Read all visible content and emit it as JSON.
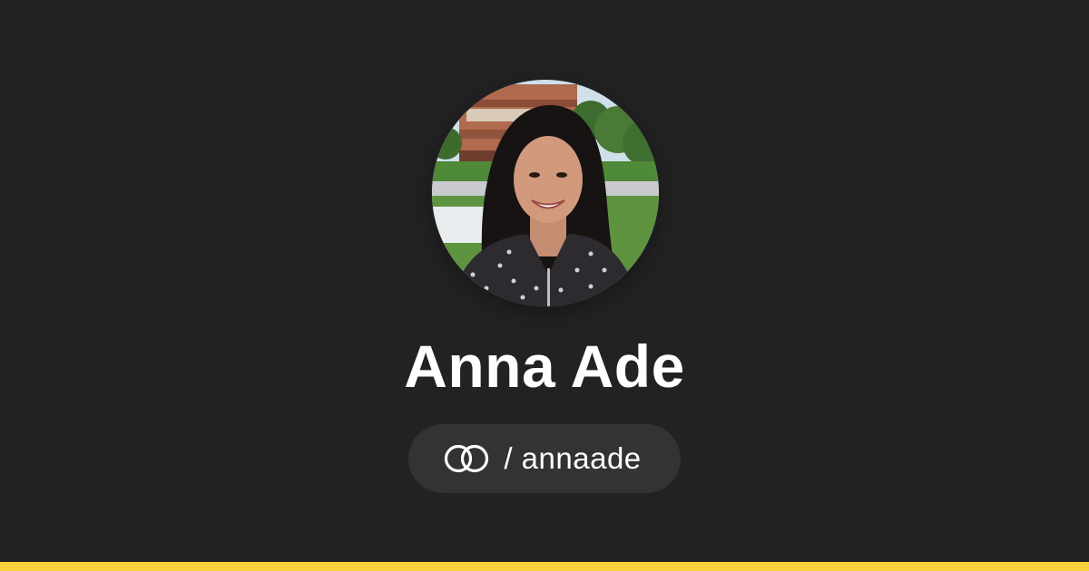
{
  "profile": {
    "name": "Anna Ade",
    "separator": "/",
    "username": "annaade",
    "handle_display": "/ annaade"
  },
  "icons": {
    "avatar": "profile-photo",
    "logo": "interlinked-rings-icon"
  },
  "colors": {
    "background": "#222222",
    "pill": "#333333",
    "text": "#ffffff",
    "accent": "#f6d33d"
  }
}
